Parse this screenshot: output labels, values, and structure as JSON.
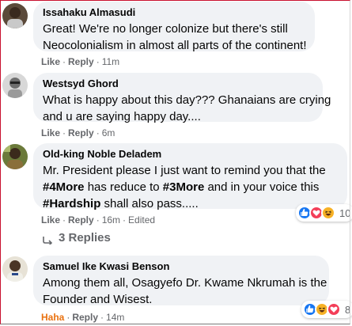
{
  "comments": [
    {
      "author": "Issahaku Almasudi",
      "lines": [
        "Great! We're no longer colonize but there's still",
        "Neocolonialism in almost all parts of the continent!"
      ],
      "like": "Like",
      "reply": "Reply",
      "time": "11m"
    },
    {
      "author": "Westsyd Ghord",
      "lines": [
        "What is happy about this day??? Ghanaians are crying",
        "and u are saying happy day...."
      ],
      "like": "Like",
      "reply": "Reply",
      "time": "6m"
    },
    {
      "author": "Old-king Noble Deladem",
      "line1": "Mr. President please I just want to remind you that the",
      "line2_a": "#4More",
      "line2_b": " has reduce to ",
      "line2_c": "#3More",
      "line2_d": " and in your voice this",
      "line3_a": "#Hardship",
      "line3_b": " shall also pass.....",
      "like": "Like",
      "reply": "Reply",
      "time": "16m",
      "edited": "Edited",
      "reaction_count": "10",
      "replies_label": "3 Replies"
    },
    {
      "author": "Samuel Ike Kwasi Benson",
      "lines": [
        "Among them all, Osagyefo Dr. Kwame Nkrumah is the",
        "Founder and Wisest."
      ],
      "like": "Haha",
      "reply": "Reply",
      "time": "14m",
      "reaction_count": "8"
    }
  ],
  "colors": {
    "bubble": "#f0f2f5",
    "meta": "#65676b",
    "haha": "#e9710f",
    "like_blue": "#1877f2",
    "love_red": "#f33e58",
    "haha_yellow": "#f7b125"
  }
}
